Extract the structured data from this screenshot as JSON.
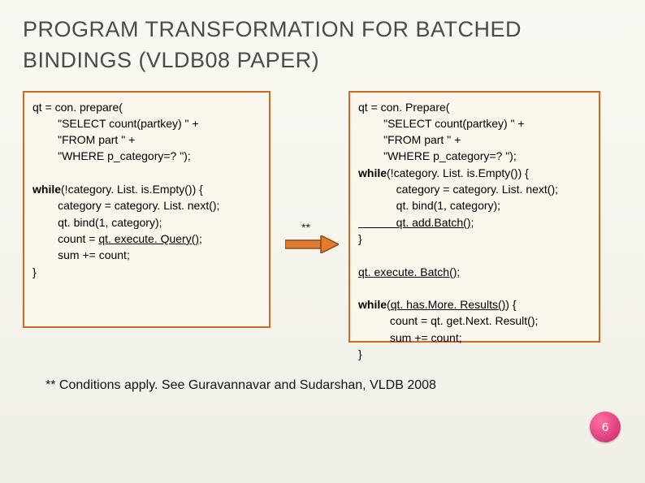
{
  "title": "PROGRAM TRANSFORMATION FOR BATCHED BINDINGS (VLDB08 PAPER)",
  "left_code": {
    "l1a": "qt = con. prepare(",
    "l1b": "        \"SELECT count(partkey) \" +",
    "l1c": "        \"FROM part \" +",
    "l1d": "        \"WHERE p_category=? \");",
    "blank1": "",
    "l2a_kw": "while",
    "l2a_rest": "(!category. List. is.Empty()) {",
    "l2b": "        category = category. List. next();",
    "l2c": "        qt. bind(1, category);",
    "l2d_a": "        count = ",
    "l2d_u": "qt. execute. Query()",
    "l2d_c": ";",
    "l2e": "        sum += count;",
    "l2f": "}"
  },
  "asterisks": "**",
  "right_code": {
    "r1a": "qt = con. Prepare(",
    "r1b": "        \"SELECT count(partkey) \" +",
    "r1c": "        \"FROM part \" +",
    "r1d": "        \"WHERE p_category=? \");",
    "r2a_kw": "while",
    "r2a_rest": "(!category. List. is.Empty()) {",
    "r2b": "            category = category. List. next();",
    "r2c": "            qt. bind(1, category);",
    "r2d_u": "            qt. add.Batch();",
    "r2e": "}",
    "blank1": "",
    "r3_u": "qt. execute. Batch();",
    "blank2": "",
    "r4a_kw": "while",
    "r4a_mid": "(",
    "r4a_u": "qt. has.More. Results()",
    "r4a_end": ") {",
    "r4b": "          count = qt. get.Next. Result();",
    "r4c": "          sum += count;",
    "r4d": "}"
  },
  "footnote": "** Conditions apply.  See Guravannavar and Sudarshan, VLDB 2008",
  "page": "6"
}
